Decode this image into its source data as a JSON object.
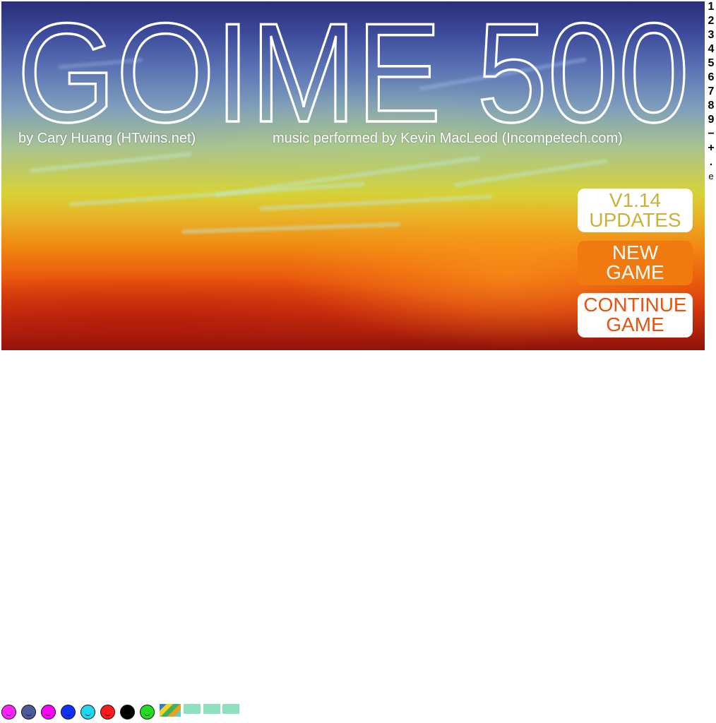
{
  "game": {
    "title": "GOIME 500",
    "credit_left": "by Cary Huang (HTwins.net)",
    "credit_right": "music performed by Kevin MacLeod (Incompetech.com)"
  },
  "menu": {
    "updates": {
      "line1": "V1.14",
      "line2": "UPDATES"
    },
    "new_game": {
      "line1": "NEW",
      "line2": "GAME"
    },
    "continue_game": {
      "line1": "CONTINUE",
      "line2": "GAME"
    }
  },
  "keypad": [
    "1",
    "2",
    "3",
    "4",
    "5",
    "6",
    "7",
    "8",
    "9",
    "−",
    "+",
    ".",
    "e"
  ],
  "palette": {
    "balls": [
      {
        "name": "magenta-ball",
        "color": "#ff22ff"
      },
      {
        "name": "slate-ball",
        "color": "#4a5a9a"
      },
      {
        "name": "magenta-ball-2",
        "color": "#ff00ff"
      },
      {
        "name": "blue-ball",
        "color": "#1030ff"
      },
      {
        "name": "cyan-ball",
        "color": "#22d6f0"
      },
      {
        "name": "red-ball",
        "color": "#ff1a1a"
      },
      {
        "name": "black-ball",
        "color": "#000000"
      },
      {
        "name": "green-ball",
        "color": "#22dd22"
      }
    ],
    "tiles": [
      {
        "name": "background-thumbnail-tile",
        "kind": "mix"
      },
      {
        "name": "mint-tile-1",
        "kind": "mint"
      },
      {
        "name": "mint-tile-2",
        "kind": "mint"
      },
      {
        "name": "mint-tile-3",
        "kind": "mint"
      }
    ]
  }
}
